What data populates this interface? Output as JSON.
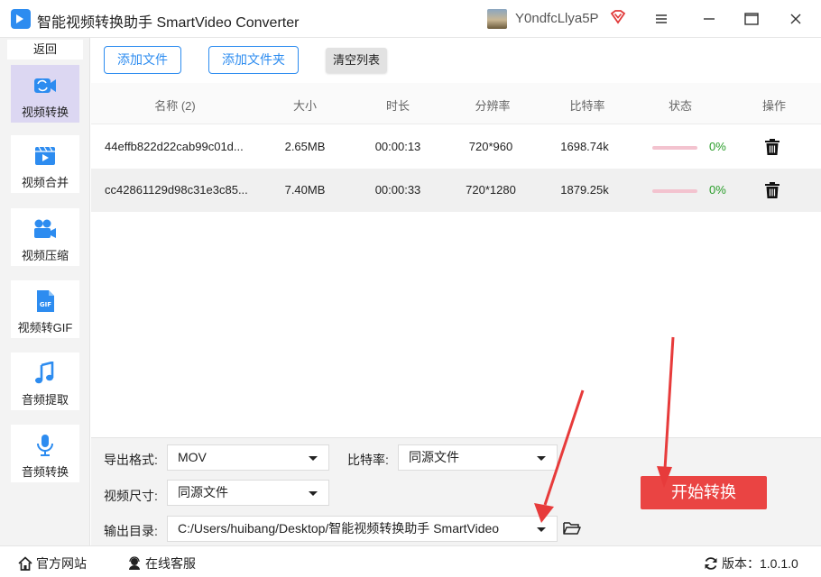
{
  "window": {
    "title": "智能视频转换助手 SmartVideo Converter",
    "user_name": "Y0ndfcLlya5P"
  },
  "sidebar": {
    "back_label": "返回",
    "items": [
      {
        "label": "视频转换",
        "icon": "video-convert-icon",
        "active": true
      },
      {
        "label": "视频合并",
        "icon": "video-merge-icon",
        "active": false
      },
      {
        "label": "视频压缩",
        "icon": "video-compress-icon",
        "active": false
      },
      {
        "label": "视频转GIF",
        "icon": "gif-icon",
        "active": false
      },
      {
        "label": "音频提取",
        "icon": "music-note-icon",
        "active": false
      },
      {
        "label": "音频转换",
        "icon": "microphone-icon",
        "active": false
      }
    ]
  },
  "toolbar": {
    "add_file": "添加文件",
    "add_folder": "添加文件夹",
    "clear_list": "清空列表"
  },
  "table": {
    "headers": {
      "name": "名称 (2)",
      "size": "大小",
      "duration": "时长",
      "resolution": "分辨率",
      "bitrate": "比特率",
      "status": "状态",
      "action": "操作"
    },
    "rows": [
      {
        "name": "44effb822d22cab99c01d...",
        "size": "2.65MB",
        "duration": "00:00:13",
        "resolution": "720*960",
        "bitrate": "1698.74k",
        "progress": "0%"
      },
      {
        "name": "cc42861129d98c31e3c85...",
        "size": "7.40MB",
        "duration": "00:00:33",
        "resolution": "720*1280",
        "bitrate": "1879.25k",
        "progress": "0%"
      }
    ]
  },
  "settings": {
    "format_label": "导出格式:",
    "format_value": "MOV",
    "bitrate_label": "比特率:",
    "bitrate_value": "同源文件",
    "size_label": "视频尺寸:",
    "size_value": "同源文件",
    "output_label": "输出目录:",
    "output_value": "C:/Users/huibang/Desktop/智能视频转换助手 SmartVideo",
    "start_label": "开始转换"
  },
  "footer": {
    "website": "官方网站",
    "support": "在线客服",
    "version": "版本：1.0.1.0"
  },
  "colors": {
    "accent": "#2d8cf0",
    "start": "#ea4443",
    "active_nav": "#dcd7f2",
    "progress_text": "#2a9d2a"
  }
}
